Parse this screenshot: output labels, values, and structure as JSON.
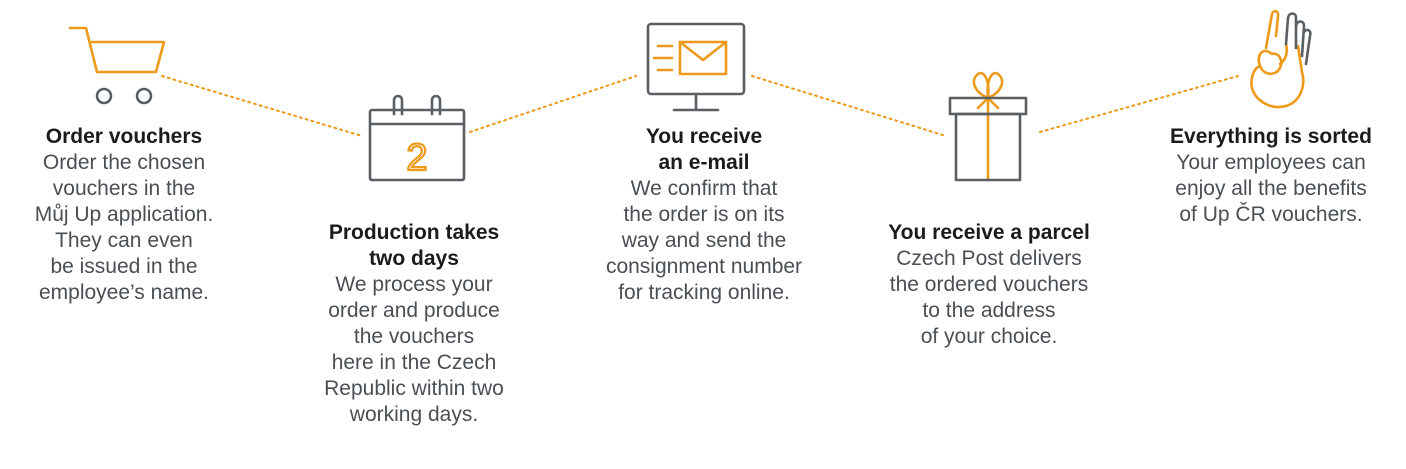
{
  "colors": {
    "accent": "#ed9a1b",
    "icon_outline": "#5a5f64",
    "title": "#1b1b1b",
    "body": "#4a4f54"
  },
  "steps": [
    {
      "icon": "shopping-cart-icon",
      "title_lines": [
        "Order vouchers"
      ],
      "body_lines": [
        "Order the chosen",
        "vouchers in the",
        "Můj Up application.",
        "They can even",
        "be issued in the",
        "employee’s name."
      ]
    },
    {
      "icon": "calendar-icon",
      "calendar_day": "2",
      "title_lines": [
        "Production takes",
        "two days"
      ],
      "body_lines": [
        "We process your",
        "order and produce",
        "the vouchers",
        "here in the Czech",
        "Republic within two",
        "working days."
      ]
    },
    {
      "icon": "email-monitor-icon",
      "title_lines": [
        "You receive",
        "an e-mail"
      ],
      "body_lines": [
        "We confirm that",
        "the order is on its",
        "way and send the",
        "consignment number",
        "for tracking online."
      ]
    },
    {
      "icon": "gift-box-icon",
      "title_lines": [
        "You receive a parcel"
      ],
      "body_lines": [
        "Czech Post delivers",
        "the ordered vouchers",
        "to the address",
        "of your choice."
      ]
    },
    {
      "icon": "ok-hand-icon",
      "title_lines": [
        "Everything is sorted"
      ],
      "body_lines": [
        "Your employees can",
        "enjoy all the benefits",
        "of Up ČR vouchers."
      ]
    }
  ]
}
